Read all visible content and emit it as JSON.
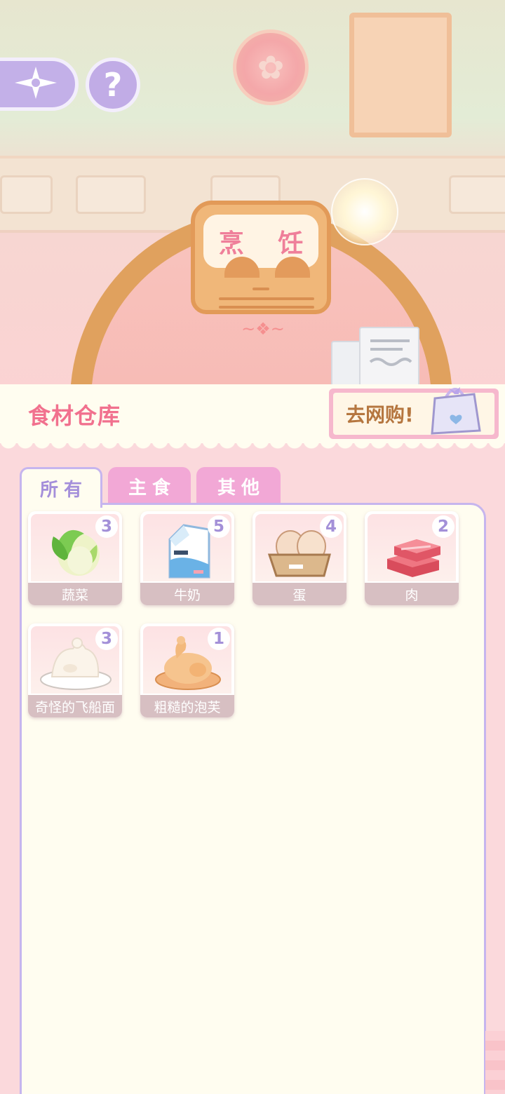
{
  "scene": {
    "sign_text": "烹 饪",
    "icons": {
      "compass": "compass-icon",
      "help": "question-icon"
    },
    "help_label": "?"
  },
  "header": {
    "title": "食材仓库",
    "shop_label": "去网购!",
    "shop_icon": "shopping-bag-icon"
  },
  "tabs": [
    {
      "label": "所有",
      "active": true
    },
    {
      "label": "主食",
      "active": false
    },
    {
      "label": "其他",
      "active": false
    }
  ],
  "items": [
    {
      "name": "蔬菜",
      "count": "3",
      "icon": "cabbage-icon"
    },
    {
      "name": "牛奶",
      "count": "5",
      "icon": "milk-carton-icon"
    },
    {
      "name": "蛋",
      "count": "4",
      "icon": "eggs-icon"
    },
    {
      "name": "肉",
      "count": "2",
      "icon": "meat-icon"
    },
    {
      "name": "奇怪的飞船面",
      "count": "3",
      "icon": "dough-plate-icon"
    },
    {
      "name": "粗糙的泡芙",
      "count": "1",
      "icon": "roast-chicken-icon"
    }
  ],
  "colors": {
    "accent_pink": "#f1718e",
    "tab_active_text": "#a48fda",
    "tab_inactive_bg": "#f2a8d6",
    "panel_border": "#c6b5ee",
    "panel_bg": "#fffdf0"
  }
}
